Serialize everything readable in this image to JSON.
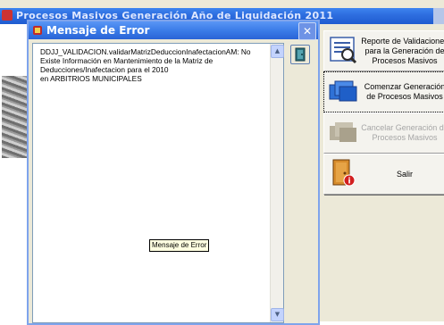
{
  "background_window": {
    "title": "Procesos Masivos Generación Año de Liquidación 2011"
  },
  "side_buttons": {
    "reporte": "Reporte de Validaciones para la Generación de Procesos Masivos",
    "comenzar": "Comenzar Generación de Procesos Masivos",
    "cancelar": "Cancelar Generación de Procesos Masivos",
    "salir": "Salir"
  },
  "dialog": {
    "title": "Mensaje de Error",
    "message": "DDJJ_VALIDACION.validarMatrizDeduccionInafectacionAM: No Existe Información en Mantenimiento de la Matriz de Deducciones/Inafectacion para el 2010\nen ARBITRIOS MUNICIPALES",
    "tooltip": "Mensaje de Error"
  },
  "colors": {
    "titlebar": "#2f6fe0",
    "dialog_bg": "#ece9d8",
    "disabled_text": "#a6a6a6"
  }
}
